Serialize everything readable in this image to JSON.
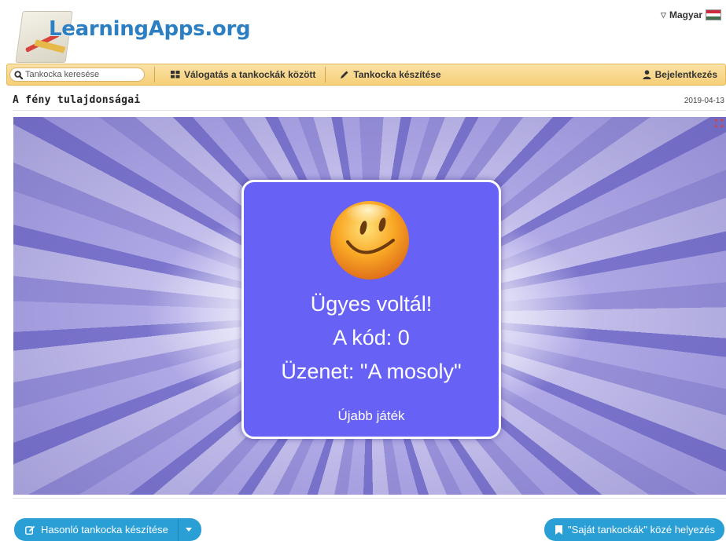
{
  "header": {
    "logo_text": "LearningApps.org",
    "language": "Magyar",
    "flag_colors": [
      "#cd2a3e",
      "#ffffff",
      "#436f4d"
    ]
  },
  "nav": {
    "search_placeholder": "Tankocka keresése",
    "browse_label": "Válogatás a tankockák között",
    "create_label": "Tankocka készítése",
    "login_label": "Bejelentkezés"
  },
  "page": {
    "title": "A fény tulajdonságai",
    "date": "2019-04-13"
  },
  "app": {
    "result_title": "Ügyes voltál!",
    "code_line": "A kód: 0",
    "message_line": "Üzenet: \"A mosoly\"",
    "replay_label": "Újabb játék",
    "dialog_color": "#6761f5"
  },
  "footer": {
    "similar_button_label": "Hasonló tankocka készítése",
    "save_button_label": "\"Saját tankockák\" közé helyezés",
    "button_color": "#2a9fd6"
  }
}
